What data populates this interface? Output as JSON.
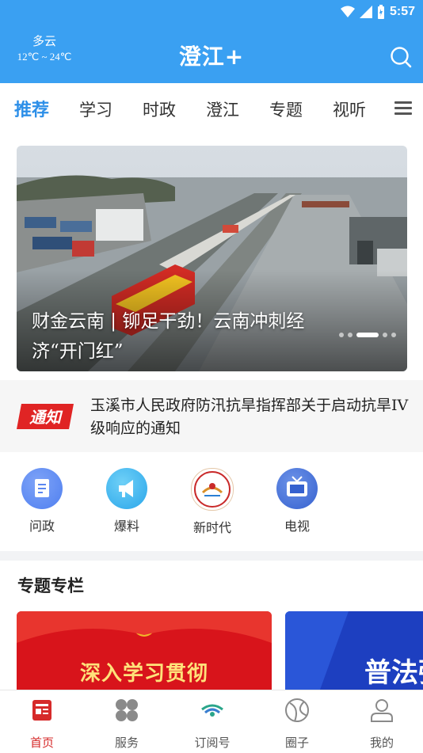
{
  "status_bar": {
    "time": "5:57"
  },
  "header": {
    "weather_condition": "多云",
    "weather_temp": "12℃ ~ 24℃",
    "title": "澄江+"
  },
  "tabs": [
    {
      "label": "推荐",
      "active": true
    },
    {
      "label": "学习"
    },
    {
      "label": "时政"
    },
    {
      "label": "澄江"
    },
    {
      "label": "专题"
    },
    {
      "label": "视听"
    }
  ],
  "banner": {
    "caption": "财金云南 | 铆足干劲！云南冲刺经济“开门红”",
    "slide_count": 5,
    "active_slide": 3
  },
  "notice": {
    "badge": "通知",
    "text": "玉溪市人民政府防汛抗旱指挥部关于启动抗旱IV级响应的通知"
  },
  "quick_links": [
    {
      "label": "问政",
      "icon": "document-icon"
    },
    {
      "label": "爆料",
      "icon": "megaphone-icon"
    },
    {
      "label": "新时代",
      "icon": "emblem-icon"
    },
    {
      "label": "电视",
      "icon": "tv-icon"
    }
  ],
  "special": {
    "title": "专题专栏",
    "cards": [
      {
        "text": "深入学习贯彻"
      },
      {
        "text": "普法强"
      }
    ]
  },
  "bottom_nav": [
    {
      "label": "首页",
      "icon": "home-news-icon",
      "active": true
    },
    {
      "label": "服务",
      "icon": "grid-icon"
    },
    {
      "label": "订阅号",
      "icon": "subscribe-icon"
    },
    {
      "label": "圈子",
      "icon": "circle-icon"
    },
    {
      "label": "我的",
      "icon": "user-icon"
    }
  ],
  "colors": {
    "header_bg": "#3aa0f2",
    "active_tab": "#2d8fe8",
    "active_nav": "#d62a2a"
  }
}
